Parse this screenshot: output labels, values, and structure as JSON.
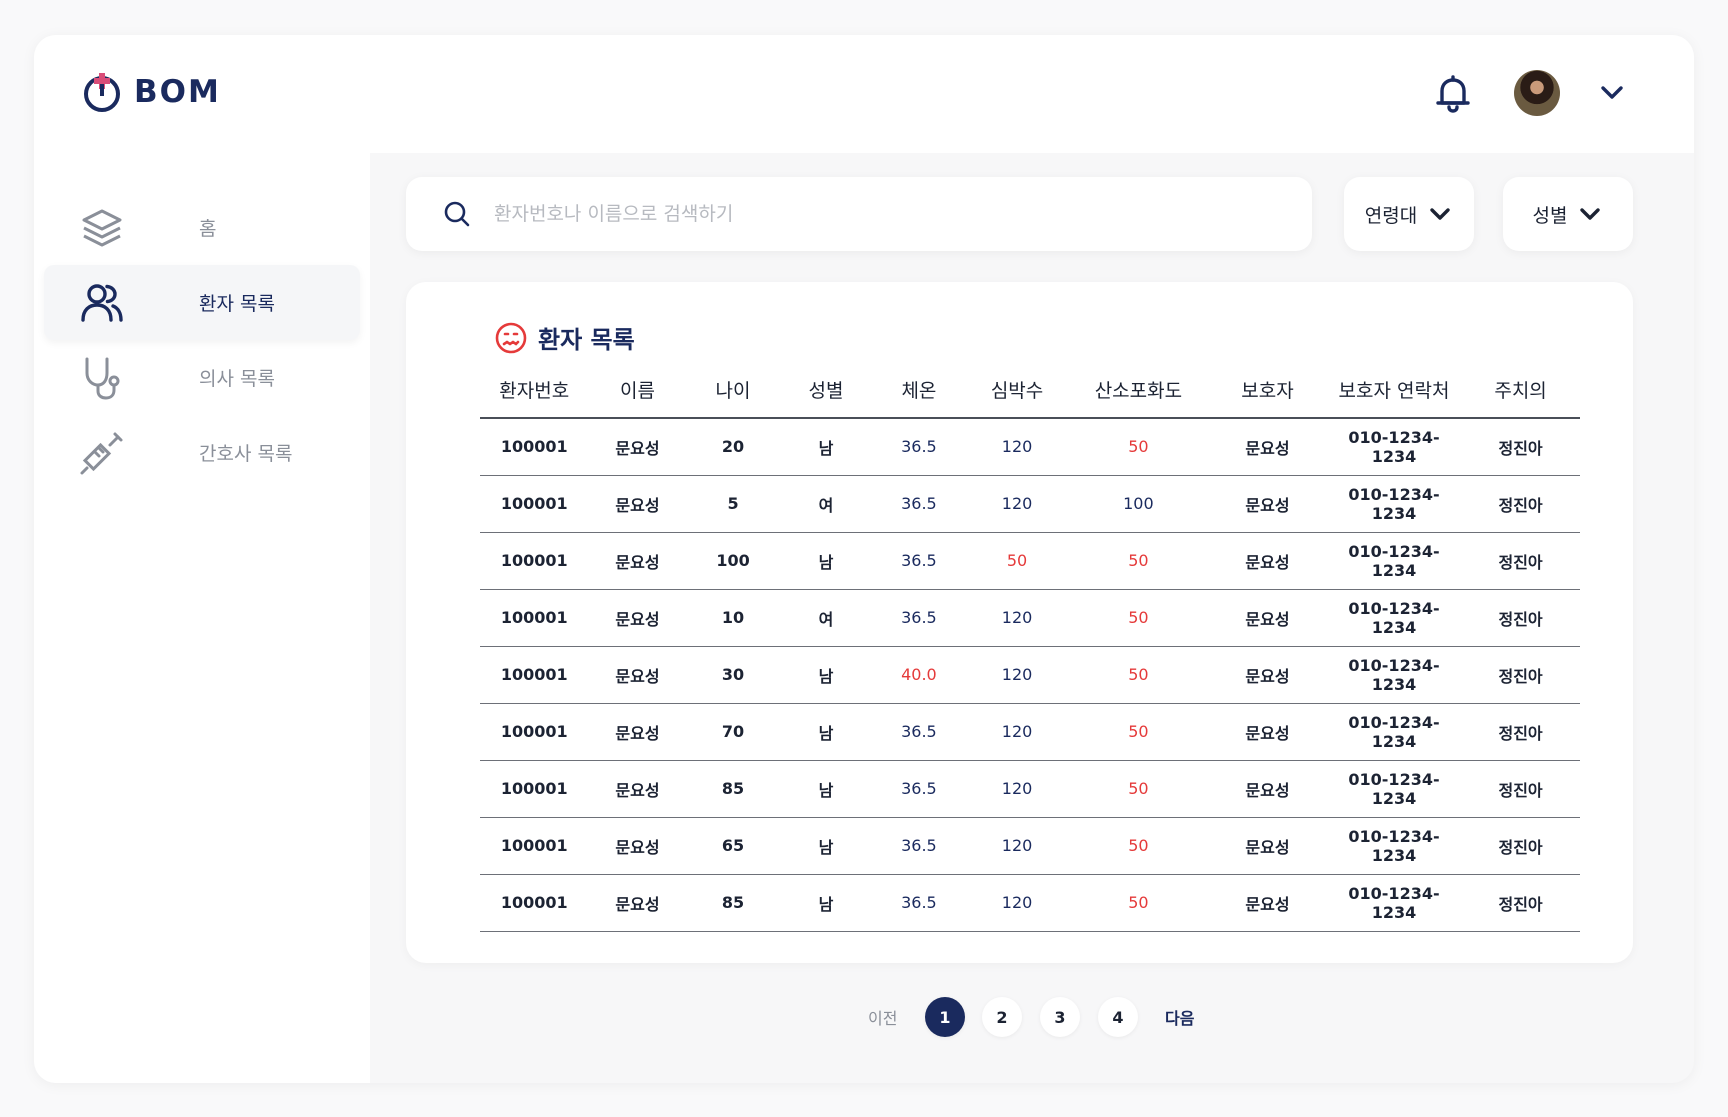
{
  "brand": {
    "name": "BOM"
  },
  "sidebar": {
    "items": [
      {
        "label": "홈",
        "icon": "layers-icon",
        "active": false
      },
      {
        "label": "환자 목록",
        "icon": "users-icon",
        "active": true
      },
      {
        "label": "의사 목록",
        "icon": "stethoscope-icon",
        "active": false
      },
      {
        "label": "간호사 목록",
        "icon": "syringe-icon",
        "active": false
      }
    ]
  },
  "header": {
    "notifications_icon": "bell-icon",
    "avatar": "user-avatar",
    "menu_icon": "chevron-down-icon"
  },
  "search": {
    "placeholder": "환자번호나 이름으로 검색하기",
    "value": ""
  },
  "filters": {
    "age": "연령대",
    "gender": "성별"
  },
  "card": {
    "title": "환자 목록",
    "columns": [
      "환자번호",
      "이름",
      "나이",
      "성별",
      "체온",
      "심박수",
      "산소포화도",
      "보호자",
      "보호자 연락처",
      "주치의"
    ],
    "rows": [
      {
        "id": "100001",
        "name": "문요성",
        "age": "20",
        "gender": "남",
        "temp": "36.5",
        "temp_alert": false,
        "hr": "120",
        "hr_alert": false,
        "spo2": "50",
        "spo2_alert": true,
        "guardian": "문요성",
        "phone": "010-1234-1234",
        "doctor": "정진아"
      },
      {
        "id": "100001",
        "name": "문요성",
        "age": "5",
        "gender": "여",
        "temp": "36.5",
        "temp_alert": false,
        "hr": "120",
        "hr_alert": false,
        "spo2": "100",
        "spo2_alert": false,
        "guardian": "문요성",
        "phone": "010-1234-1234",
        "doctor": "정진아"
      },
      {
        "id": "100001",
        "name": "문요성",
        "age": "100",
        "gender": "남",
        "temp": "36.5",
        "temp_alert": false,
        "hr": "50",
        "hr_alert": true,
        "spo2": "50",
        "spo2_alert": true,
        "guardian": "문요성",
        "phone": "010-1234-1234",
        "doctor": "정진아"
      },
      {
        "id": "100001",
        "name": "문요성",
        "age": "10",
        "gender": "여",
        "temp": "36.5",
        "temp_alert": false,
        "hr": "120",
        "hr_alert": false,
        "spo2": "50",
        "spo2_alert": true,
        "guardian": "문요성",
        "phone": "010-1234-1234",
        "doctor": "정진아"
      },
      {
        "id": "100001",
        "name": "문요성",
        "age": "30",
        "gender": "남",
        "temp": "40.0",
        "temp_alert": true,
        "hr": "120",
        "hr_alert": false,
        "spo2": "50",
        "spo2_alert": true,
        "guardian": "문요성",
        "phone": "010-1234-1234",
        "doctor": "정진아"
      },
      {
        "id": "100001",
        "name": "문요성",
        "age": "70",
        "gender": "남",
        "temp": "36.5",
        "temp_alert": false,
        "hr": "120",
        "hr_alert": false,
        "spo2": "50",
        "spo2_alert": true,
        "guardian": "문요성",
        "phone": "010-1234-1234",
        "doctor": "정진아"
      },
      {
        "id": "100001",
        "name": "문요성",
        "age": "85",
        "gender": "남",
        "temp": "36.5",
        "temp_alert": false,
        "hr": "120",
        "hr_alert": false,
        "spo2": "50",
        "spo2_alert": true,
        "guardian": "문요성",
        "phone": "010-1234-1234",
        "doctor": "정진아"
      },
      {
        "id": "100001",
        "name": "문요성",
        "age": "65",
        "gender": "남",
        "temp": "36.5",
        "temp_alert": false,
        "hr": "120",
        "hr_alert": false,
        "spo2": "50",
        "spo2_alert": true,
        "guardian": "문요성",
        "phone": "010-1234-1234",
        "doctor": "정진아"
      },
      {
        "id": "100001",
        "name": "문요성",
        "age": "85",
        "gender": "남",
        "temp": "36.5",
        "temp_alert": false,
        "hr": "120",
        "hr_alert": false,
        "spo2": "50",
        "spo2_alert": true,
        "guardian": "문요성",
        "phone": "010-1234-1234",
        "doctor": "정진아"
      }
    ]
  },
  "pagination": {
    "prev": "이전",
    "next": "다음",
    "pages": [
      "1",
      "2",
      "3",
      "4"
    ],
    "current": "1"
  },
  "colors": {
    "navy": "#1a2a5e",
    "alert": "#e53a3a",
    "muted": "#8a8f99"
  }
}
